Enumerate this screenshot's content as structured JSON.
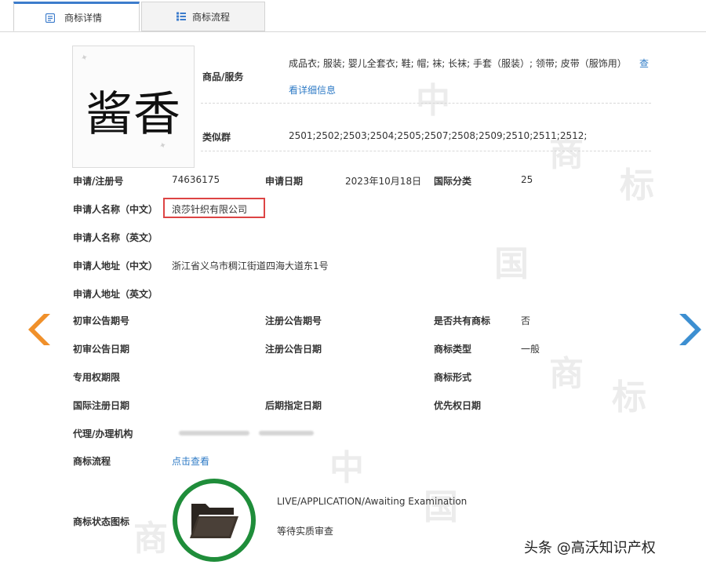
{
  "tabs": [
    {
      "label": "商标详情",
      "active": true
    },
    {
      "label": "商标流程",
      "active": false
    }
  ],
  "mark": {
    "text": "酱香"
  },
  "goods": {
    "label": "商品/服务",
    "value": "成品衣; 服装; 婴儿全套衣; 鞋; 帽; 袜; 长袜; 手套（服装）; 领带; 皮带（服饰用）",
    "more": "查",
    "detail_link": "看详细信息"
  },
  "similar_group": {
    "label": "类似群",
    "value": "2501;2502;2503;2504;2505;2507;2508;2509;2510;2511;2512;"
  },
  "fields": {
    "reg_no_label": "申请/注册号",
    "reg_no": "74636175",
    "app_date_label": "申请日期",
    "app_date": "2023年10月18日",
    "intl_class_label": "国际分类",
    "intl_class": "25",
    "applicant_cn_label": "申请人名称（中文）",
    "applicant_cn": "浪莎针织有限公司",
    "applicant_en_label": "申请人名称（英文）",
    "addr_cn_label": "申请人地址（中文）",
    "addr_cn": "浙江省义乌市稠江街道四海大道东1号",
    "addr_en_label": "申请人地址（英文）",
    "prelim_no_label": "初审公告期号",
    "reg_ann_no_label": "注册公告期号",
    "shared_label": "是否共有商标",
    "shared": "否",
    "prelim_date_label": "初审公告日期",
    "reg_ann_date_label": "注册公告日期",
    "mark_type_label": "商标类型",
    "mark_type": "一般",
    "exclusive_label": "专用权期限",
    "mark_form_label": "商标形式",
    "intl_reg_date_label": "国际注册日期",
    "later_date_label": "后期指定日期",
    "priority_date_label": "优先权日期",
    "agent_label": "代理/办理机构",
    "flow_label": "商标流程",
    "flow_link": "点击查看",
    "status_icon_label": "商标状态图标",
    "status_en": "LIVE/APPLICATION/Awaiting Examination",
    "status_cn": "等待实质审查"
  },
  "footer": {
    "watermark": "头条 @高沃知识产权"
  },
  "colors": {
    "accent": "#3c7ccc",
    "link": "#2f7bc6",
    "highlight": "#dd4444",
    "status": "#1f8d3a",
    "nav_left": "#f0902a",
    "nav_right": "#3d8fd1"
  }
}
